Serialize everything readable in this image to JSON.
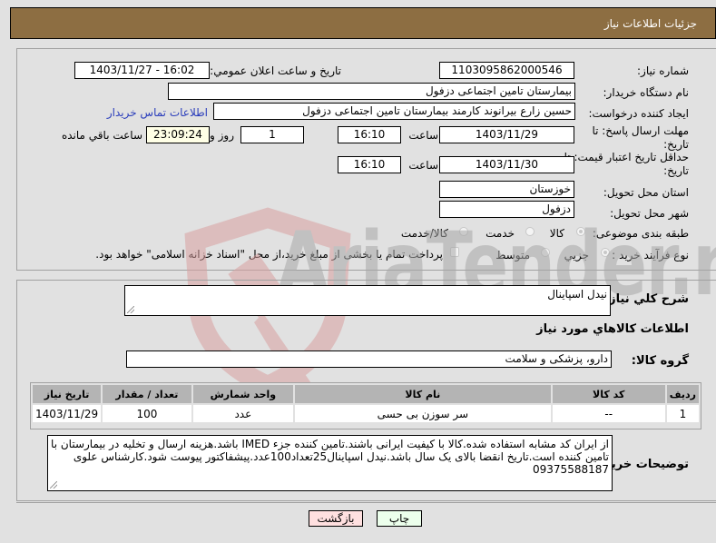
{
  "header": {
    "title": "جزئیات اطلاعات نیاز"
  },
  "form": {
    "need_number": {
      "label": "شماره نیاز:",
      "value": "1103095862000546"
    },
    "announce": {
      "label": "تاریخ و ساعت اعلان عمومي:",
      "value": "1403/11/27 - 16:02"
    },
    "buyer_org": {
      "label": "نام دستگاه خریدار:",
      "value": "بیمارستان تامین اجتماعی دزفول"
    },
    "creator": {
      "label": "ایجاد کننده درخواست:",
      "value": "حسین زارع بیرانوند کارمند بیمارستان تامین اجتماعی دزفول",
      "contact_link": "اطلاعات تماس خریدار"
    },
    "reply_deadline": {
      "label": "مهلت ارسال پاسخ: تا تاریخ:",
      "date": "1403/11/29",
      "time_label": "ساعت",
      "time": "16:10",
      "days": "1",
      "days_label": "روز و",
      "remaining": "23:09:24",
      "remaining_label": "ساعت باقي مانده"
    },
    "price_validity": {
      "label": "حداقل تاریخ اعتبار قیمت: تا تاریخ:",
      "date": "1403/11/30",
      "time_label": "ساعت",
      "time": "16:10"
    },
    "province": {
      "label": "استان محل تحویل:",
      "value": "خوزستان"
    },
    "city": {
      "label": "شهر محل تحویل:",
      "value": "دزفول"
    },
    "category": {
      "label": "طبقه بندی موضوعی:",
      "options": [
        {
          "label": "کالا",
          "selected": true
        },
        {
          "label": "خدمت",
          "selected": false
        },
        {
          "label": "کالا/خدمت",
          "selected": false
        }
      ]
    },
    "process": {
      "label": "نوع فرآیند خرید :",
      "options": [
        {
          "label": "جزیي",
          "selected": true
        },
        {
          "label": "متوسط",
          "selected": false
        }
      ],
      "treasury_checkbox": {
        "checked": false,
        "label": "پرداخت تمام یا بخشی از مبلغ خرید،از محل \"اسناد خزانه اسلامی\" خواهد بود."
      }
    }
  },
  "details": {
    "summary_label": "شرح کلي نیاز:",
    "summary_value": "نیدل اسپاینال",
    "items_heading": "اطلاعات کالاهاي مورد نیاز",
    "group_label": "گروه کالا:",
    "group_value": "دارو، پزشکی و سلامت",
    "table": {
      "columns": [
        "ردیف",
        "کد کالا",
        "نام کالا",
        "واحد شمارش",
        "تعداد / مقدار",
        "تاریخ نیاز"
      ],
      "rows": [
        [
          "1",
          "--",
          "سر سوزن بی حسی",
          "عدد",
          "100",
          "1403/11/29"
        ]
      ]
    },
    "buyer_notes_label": "توضیحات خریدار:",
    "buyer_notes": "از ایران کد مشابه استفاده شده.کالا با کیفیت ایرانی باشند.تامین کننده جزء IMED باشد.هزینه ارسال و تخلیه در بیمارستان با تامین کننده است.تاریخ انقضا بالای یک سال باشد.نیدل اسپاینال25تعداد100عدد.پیشفاکتور پیوست شود.کارشناس علوی 09375588187"
  },
  "buttons": {
    "print": "چاپ",
    "back": "بازگشت"
  },
  "watermark": {
    "text": "AriaTender.neT"
  },
  "colors": {
    "header_bg": "#8d6e42",
    "link": "#2a3dbb",
    "back_btn": "#ffe0e0",
    "print_btn": "#ecffec",
    "table_header": "#b4b4b4"
  }
}
